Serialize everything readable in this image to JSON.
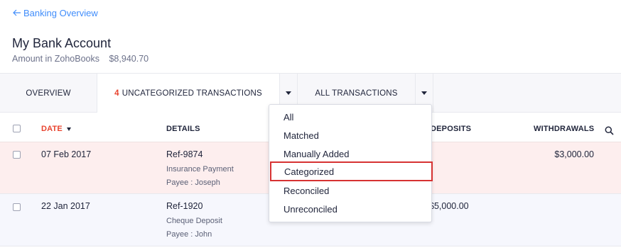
{
  "nav": {
    "back_label": "Banking Overview"
  },
  "header": {
    "title": "My Bank Account",
    "amount_label": "Amount in ZohoBooks",
    "amount_value": "$8,940.70"
  },
  "tabs": {
    "overview": "OVERVIEW",
    "uncategorized_count": "4",
    "uncategorized_label": "UNCATEGORIZED TRANSACTIONS",
    "all": "ALL TRANSACTIONS"
  },
  "table": {
    "columns": {
      "date": "DATE",
      "details": "DETAILS",
      "deposits": "DEPOSITS",
      "withdrawals": "WITHDRAWALS"
    },
    "rows": [
      {
        "date": "07 Feb 2017",
        "ref": "Ref-9874",
        "desc": "Insurance Payment",
        "payee": "Payee : Joseph",
        "deposit": "",
        "withdrawal": "$3,000.00"
      },
      {
        "date": "22 Jan 2017",
        "ref": "Ref-1920",
        "desc": "Cheque Deposit",
        "payee": "Payee : John",
        "deposit": "$5,000.00",
        "withdrawal": ""
      }
    ]
  },
  "dropdown": {
    "options": [
      "All",
      "Matched",
      "Manually Added",
      "Categorized",
      "Reconciled",
      "Unreconciled"
    ],
    "highlighted": "Categorized"
  },
  "colors": {
    "link": "#408dfb",
    "accent_red": "#e8442f",
    "highlight_border": "#d63232",
    "row_highlight": "#fdeeee"
  }
}
